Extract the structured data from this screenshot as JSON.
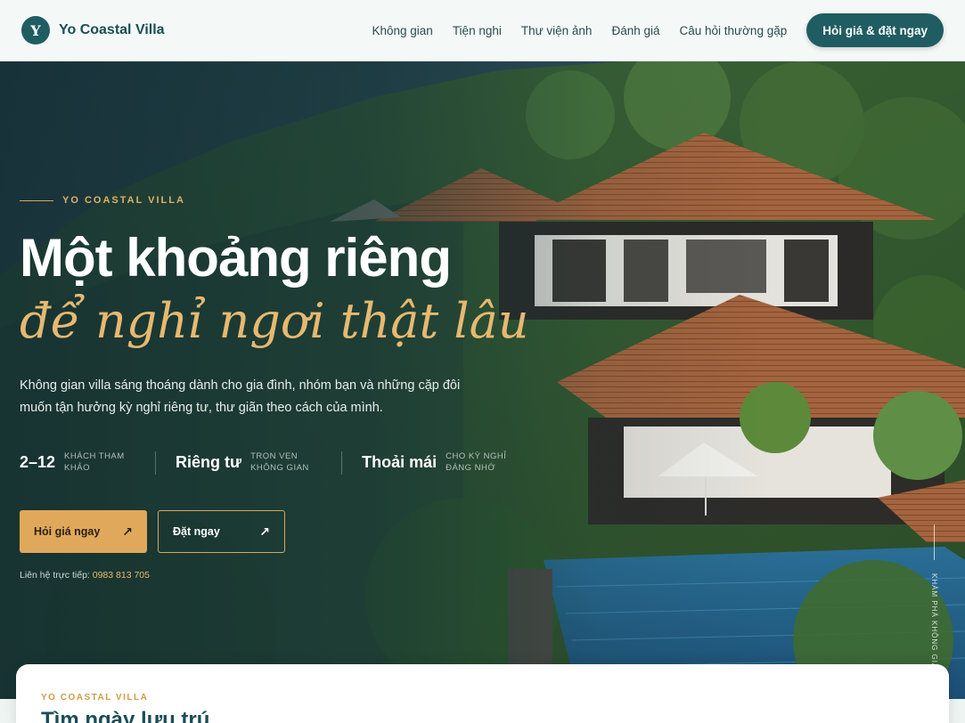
{
  "header": {
    "logo_letter": "Y",
    "brand": "Yo Coastal Villa",
    "nav": [
      "Không gian",
      "Tiện nghi",
      "Thư viện ảnh",
      "Đánh giá",
      "Câu hỏi thường gặp"
    ],
    "cta": "Hỏi giá & đặt ngay"
  },
  "hero": {
    "eyebrow": "YO COASTAL VILLA",
    "title_line1": "Một khoảng riêng",
    "title_line2": "để nghỉ ngơi thật lâu",
    "lead": "Không gian villa sáng thoáng dành cho gia đình, nhóm bạn và những cặp đôi muốn tận hưởng kỳ nghỉ riêng tư, thư giãn theo cách của mình.",
    "stats": [
      {
        "value": "2–12",
        "label": "KHÁCH THAM KHẢO"
      },
      {
        "value": "Riêng tư",
        "label": "TRỌN VẸN KHÔNG GIAN"
      },
      {
        "value": "Thoải mái",
        "label": "CHO KỲ NGHỈ ĐÁNG NHỚ"
      }
    ],
    "primary_button": "Hỏi giá ngay",
    "secondary_button": "Đặt ngay",
    "arrow": "↗",
    "contact_label": "Liên hệ trực tiếp:",
    "contact_phone": "0983 813 705",
    "side_caption": "KHÁM PHÁ KHÔNG GIAN"
  },
  "booking": {
    "eyebrow": "YO COASTAL VILLA",
    "title": "Tìm ngày lưu trú"
  },
  "colors": {
    "brand_teal": "#1f5d63",
    "accent_gold": "#e0a85a",
    "header_bg": "#f4f9f8"
  }
}
